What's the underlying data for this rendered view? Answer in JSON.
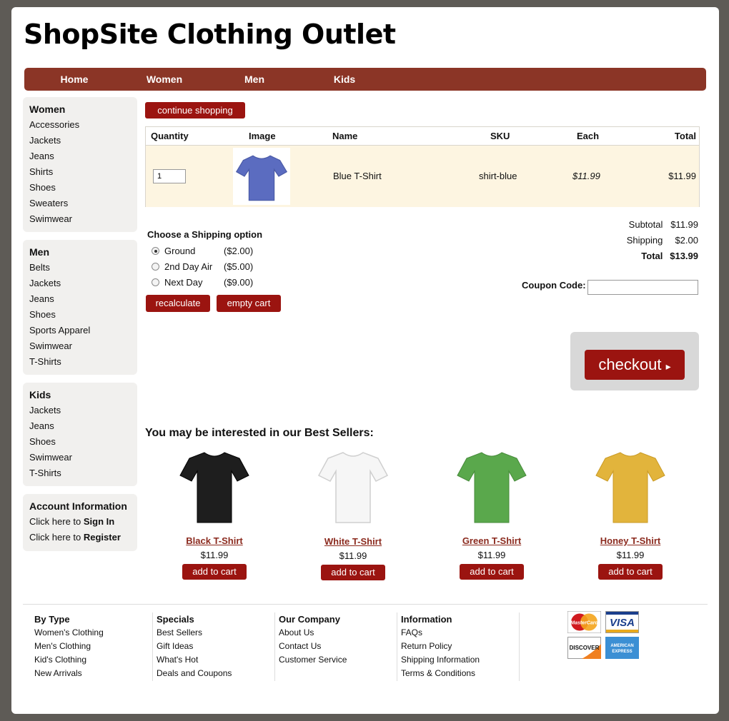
{
  "site": {
    "title": "ShopSite Clothing Outlet"
  },
  "nav": [
    "Home",
    "Women",
    "Men",
    "Kids"
  ],
  "sidebar": {
    "women": {
      "title": "Women",
      "items": [
        "Accessories",
        "Jackets",
        "Jeans",
        "Shirts",
        "Shoes",
        "Sweaters",
        "Swimwear"
      ]
    },
    "men": {
      "title": "Men",
      "items": [
        "Belts",
        "Jackets",
        "Jeans",
        "Shoes",
        "Sports Apparel",
        "Swimwear",
        "T-Shirts"
      ]
    },
    "kids": {
      "title": "Kids",
      "items": [
        "Jackets",
        "Jeans",
        "Shoes",
        "Swimwear",
        "T-Shirts"
      ]
    },
    "account": {
      "title": "Account Information",
      "signin_prefix": "Click here to ",
      "signin_bold": "Sign In",
      "register_prefix": "Click here to ",
      "register_bold": "Register"
    }
  },
  "cart": {
    "continue_label": "continue shopping",
    "headers": {
      "quantity": "Quantity",
      "image": "Image",
      "name": "Name",
      "sku": "SKU",
      "each": "Each",
      "total": "Total"
    },
    "items": [
      {
        "quantity": "1",
        "image_icon": "blue-tshirt",
        "name": "Blue T-Shirt",
        "sku": "shirt-blue",
        "each": "$11.99",
        "total": "$11.99"
      }
    ]
  },
  "shipping": {
    "title": "Choose a Shipping option",
    "options": [
      {
        "name": "Ground",
        "price": "($2.00)",
        "selected": true
      },
      {
        "name": "2nd Day Air",
        "price": "($5.00)",
        "selected": false
      },
      {
        "name": "Next Day",
        "price": "($9.00)",
        "selected": false
      }
    ],
    "recalculate_label": "recalculate",
    "empty_label": "empty cart"
  },
  "totals": {
    "subtotal_label": "Subtotal",
    "subtotal": "$11.99",
    "shipping_label": "Shipping",
    "shipping": "$2.00",
    "total_label": "Total",
    "total": "$13.99"
  },
  "coupon": {
    "label": "Coupon Code:",
    "value": ""
  },
  "checkout": {
    "label": "checkout",
    "arrow": "▸"
  },
  "best_sellers": {
    "title": "You may be interested in our Best Sellers:",
    "products": [
      {
        "name": "Black T-Shirt",
        "price": "$11.99",
        "add_label": "add to cart",
        "color": "#1e1e1e"
      },
      {
        "name": "White T-Shirt",
        "price": "$11.99",
        "add_label": "add to cart",
        "color": "#f6f6f6"
      },
      {
        "name": "Green T-Shirt",
        "price": "$11.99",
        "add_label": "add to cart",
        "color": "#5aa84c"
      },
      {
        "name": "Honey T-Shirt",
        "price": "$11.99",
        "add_label": "add to cart",
        "color": "#e2b43c"
      }
    ]
  },
  "footer": {
    "columns": [
      {
        "title": "By Type",
        "links": [
          "Women's Clothing",
          "Men's Clothing",
          "Kid's Clothing",
          "New Arrivals"
        ]
      },
      {
        "title": "Specials",
        "links": [
          "Best Sellers",
          "Gift Ideas",
          "What's Hot",
          "Deals and Coupons"
        ]
      },
      {
        "title": "Our Company",
        "links": [
          "About Us",
          "Contact Us",
          "Customer Service"
        ]
      },
      {
        "title": "Information",
        "links": [
          "FAQs",
          "Return Policy",
          "Shipping Information",
          "Terms & Conditions"
        ]
      }
    ],
    "cards": {
      "mastercard": "MasterCard",
      "visa": "VISA",
      "discover": "DISCOVER",
      "amex_line1": "AMERICAN",
      "amex_line2": "EXPRESS"
    }
  },
  "colors": {
    "nav": "#8b3526",
    "button": "#9b1410",
    "cart_row": "#fdf5e1",
    "blue_shirt": "#5b6cc0"
  }
}
